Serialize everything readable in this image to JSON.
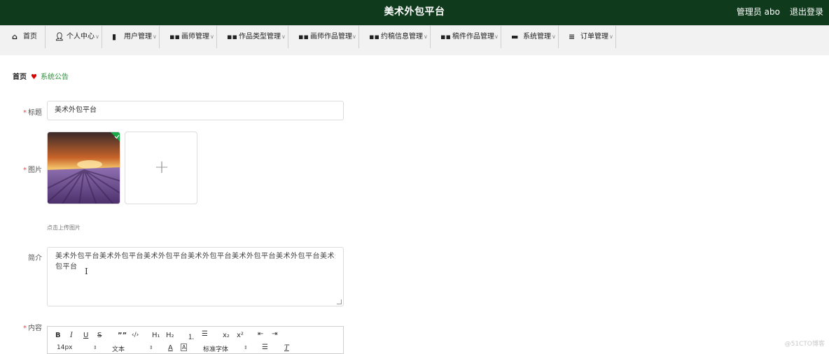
{
  "header": {
    "title": "美术外包平台",
    "admin_label": "管理员 abo",
    "logout_label": "退出登录",
    "bg_color": "#0f3a1c"
  },
  "nav": {
    "items": [
      {
        "icon": "home-icon",
        "label": "首页",
        "has_dropdown": false
      },
      {
        "icon": "user-icon",
        "label": "个人中心",
        "has_dropdown": true
      },
      {
        "icon": "bar-chart-icon",
        "label": "用户管理",
        "has_dropdown": true
      },
      {
        "icon": "grid-icon",
        "label": "画师管理",
        "has_dropdown": true
      },
      {
        "icon": "grid-icon",
        "label": "作品类型管理",
        "has_dropdown": true
      },
      {
        "icon": "grid-icon",
        "label": "画师作品管理",
        "has_dropdown": true
      },
      {
        "icon": "grid-icon",
        "label": "约稿信息管理",
        "has_dropdown": true
      },
      {
        "icon": "grid-icon",
        "label": "稿件作品管理",
        "has_dropdown": true
      },
      {
        "icon": "chat-icon",
        "label": "系统管理",
        "has_dropdown": true
      },
      {
        "icon": "list-icon",
        "label": "订单管理",
        "has_dropdown": true
      }
    ]
  },
  "breadcrumb": {
    "home": "首页",
    "current": "系统公告"
  },
  "form": {
    "title": {
      "label": "标题",
      "required": true,
      "value": "美术外包平台"
    },
    "image": {
      "label": "图片",
      "required": true,
      "hint": "点击上传图片"
    },
    "intro": {
      "label": "简介",
      "required": false,
      "line1": "美术外包平台美术外包平台美术外包平台美术外包平台美术外包平台美术外包平台美术外",
      "line2": "包平台"
    },
    "content": {
      "label": "内容",
      "required": true
    }
  },
  "editor": {
    "toolbar": {
      "bold": "B",
      "italic": "I",
      "underline": "U",
      "strike": "S",
      "quote": "””",
      "code": "‹/›",
      "h1": "H₁",
      "h2": "H₂",
      "sub": "x₂",
      "sup": "x²"
    },
    "font_size": "14px",
    "text_type": "文本",
    "font_family": "标准字体"
  },
  "watermark": "@51CTO博客"
}
